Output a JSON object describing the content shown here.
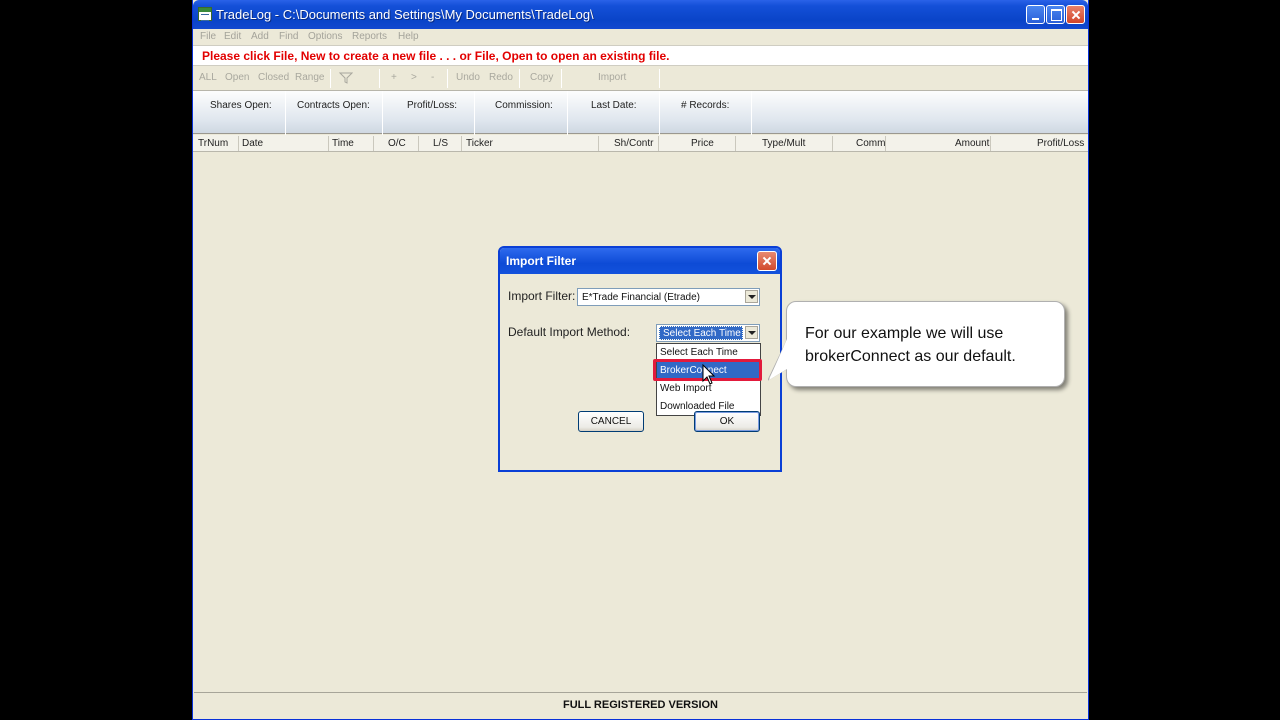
{
  "window": {
    "title": "TradeLog - C:\\Documents and Settings\\My Documents\\TradeLog\\"
  },
  "menu": [
    "File",
    "Edit",
    "Add",
    "Find",
    "Options",
    "Reports",
    "Help"
  ],
  "message": "Please click File, New to create a new file . . . or File, Open to open an existing file.",
  "toolbar": {
    "all": "ALL",
    "open": "Open",
    "closed": "Closed",
    "range": "Range",
    "filter_icon": "filter-icon",
    "plus": "+",
    "next": ">",
    "minus": "-",
    "undo": "Undo",
    "redo": "Redo",
    "copy": "Copy",
    "import": "Import"
  },
  "stats": [
    "Shares Open:",
    "Contracts Open:",
    "Profit/Loss:",
    "Commission:",
    "Last Date:",
    "# Records:"
  ],
  "columns": [
    "TrNum",
    "Date",
    "Time",
    "O/C",
    "L/S",
    "Ticker",
    "Sh/Contr",
    "Price",
    "Type/Mult",
    "Comm",
    "Amount",
    "Profit/Loss"
  ],
  "status": "FULL REGISTERED VERSION",
  "dialog": {
    "title": "Import Filter",
    "import_filter_label": "Import Filter:",
    "import_filter_value": "E*Trade Financial (Etrade)",
    "method_label": "Default Import Method:",
    "method_value": "Select Each Time",
    "method_options": [
      "Select Each Time",
      "BrokerConnect",
      "Web Import",
      "Downloaded File"
    ],
    "highlighted_option": "BrokerConnect",
    "cancel_label": "CANCEL",
    "ok_label": "OK"
  },
  "callout": {
    "text": "For our example we will use brokerConnect as our default."
  },
  "colors": {
    "title_blue": "#0a44c8",
    "message_red": "#e20000",
    "selection_blue": "#3169c6",
    "highlight_red": "#e21a3c",
    "window_face": "#ece9d8"
  }
}
